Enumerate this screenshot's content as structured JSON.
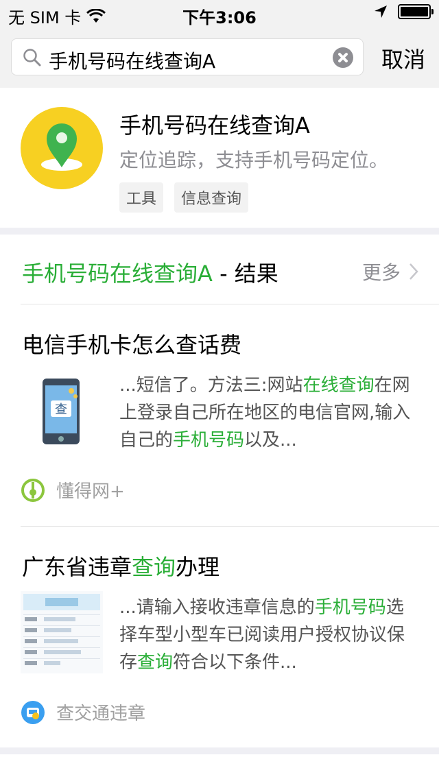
{
  "status": {
    "carrier": "无 SIM 卡",
    "time": "下午3:06"
  },
  "search": {
    "value": "手机号码在线查询A",
    "cancel": "取消"
  },
  "app": {
    "title": "手机号码在线查询A",
    "desc": "定位追踪，支持手机号码定位。",
    "tags": [
      "工具",
      "信息查询"
    ]
  },
  "section": {
    "title_hl": "手机号码在线查询A",
    "title_rest": " - 结果",
    "more": "更多"
  },
  "results": [
    {
      "title": "电信手机卡怎么查话费",
      "snippet_parts": [
        "...短信了。方法三:网站",
        "在线查询",
        "在网上登录自己所在地区的电信官网,输入自己的",
        "手机号码",
        "以及..."
      ],
      "source": "懂得网+"
    },
    {
      "title_parts": [
        "广东省违章",
        "查询",
        "办理"
      ],
      "snippet_parts": [
        "...请输入接收违章信息的",
        "手机号码",
        "选择车型小型车已阅读用户授权协议保存",
        "查询",
        "符合以下条件..."
      ],
      "source": "查交通违章"
    }
  ],
  "colors": {
    "accent": "#2aae37",
    "logo_bg": "#f7d022"
  }
}
